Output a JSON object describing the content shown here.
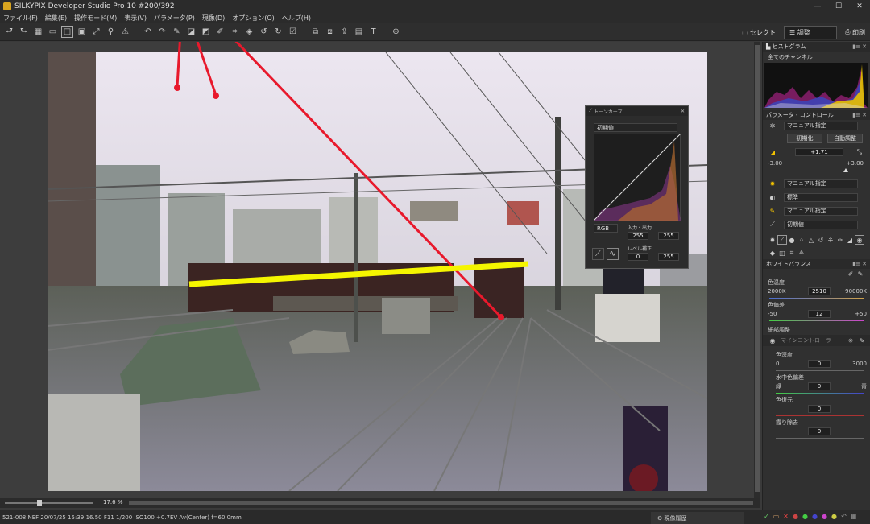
{
  "window": {
    "title": "SILKYPIX Developer Studio Pro 10   #200/392",
    "minimize": "—",
    "maximize": "☐",
    "close": "✕"
  },
  "menu": [
    "ファイル(F)",
    "編集(E)",
    "操作モード(M)",
    "表示(V)",
    "パラメータ(P)",
    "現像(D)",
    "オプション(O)",
    "ヘルプ(H)"
  ],
  "toolbar_right": {
    "select": "セレクト",
    "adjust": "調整",
    "print": "印刷"
  },
  "zoom": {
    "value": "17.6",
    "unit": "%"
  },
  "status": {
    "info": "521-008.NEF 20/07/25 15:39:16.50 F11 1/200 ISO100 +0.7EV Av(Center) f=60.0mm",
    "dock_label": "現像履歴"
  },
  "tone_curve": {
    "title": "トーンカーブ",
    "preset": "初期値",
    "channel": "RGB",
    "io_label": "入力・出力",
    "in_val": "255",
    "out_val": "255",
    "level_label": "レベル補正",
    "level_low": "0",
    "level_high": "255"
  },
  "panel": {
    "histogram": {
      "title": "ヒストグラム",
      "channel": "全てのチャンネル"
    },
    "param": {
      "title": "パラメータ・コントロール",
      "preset": "マニュアル指定",
      "init_btn": "初期化",
      "auto_btn": "自動調整"
    },
    "exposure": {
      "value": "+1.71",
      "min": "-3.00",
      "max": "+3.00"
    },
    "rows": [
      {
        "icon": "sun-icon",
        "value": "マニュアル指定"
      },
      {
        "icon": "contrast-icon",
        "value": "標準"
      },
      {
        "icon": "pen-icon",
        "value": "マニュアル指定"
      },
      {
        "icon": "curve-icon",
        "value": "初期値"
      }
    ],
    "wb": {
      "title": "ホワイトバランス",
      "temp_label": "色温度",
      "temp_min": "2000K",
      "temp_val": "2510",
      "temp_max": "90000K",
      "tint_label": "色偏差",
      "tint_min": "-50",
      "tint_val": "12",
      "tint_max": "+50"
    },
    "fine": {
      "title": "細部調整",
      "sub": "マインコントローラ",
      "depth_label": "色深度",
      "depth_min": "0",
      "depth_val": "0",
      "depth_max": "3000",
      "hue_label": "水中色偏差",
      "hue_min": "緑",
      "hue_val": "0",
      "hue_max": "青",
      "restore_label": "色復元",
      "restore_val": "0",
      "haze_label": "霞り除去",
      "haze_val": "0"
    }
  },
  "colors": {
    "accent": "#f2c200",
    "annot_red": "#e8192c",
    "annot_yellow": "#f5f500"
  }
}
